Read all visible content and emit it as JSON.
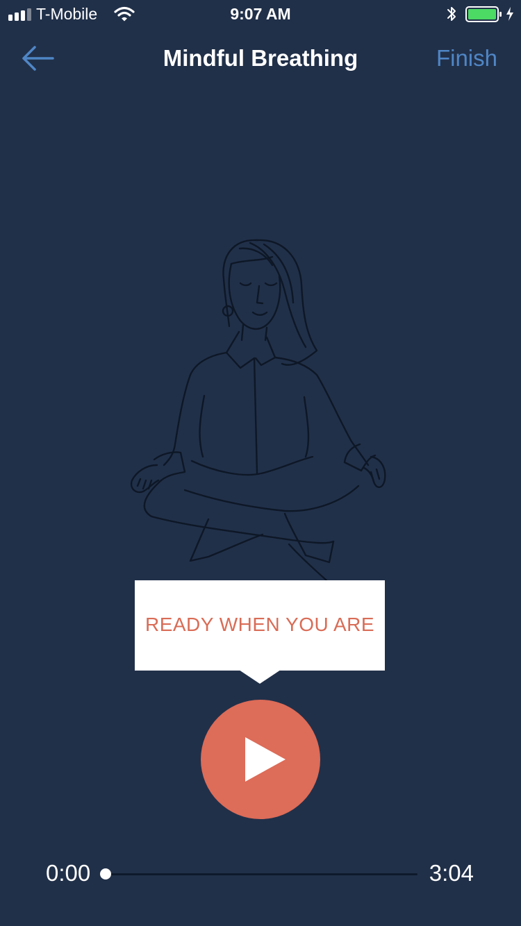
{
  "status_bar": {
    "carrier": "T-Mobile",
    "time": "9:07 AM",
    "icons": [
      "signal-icon",
      "wifi-icon",
      "bluetooth-icon",
      "battery-icon",
      "charging-icon"
    ]
  },
  "nav": {
    "back_icon": "arrow-left-icon",
    "title": "Mindful Breathing",
    "finish_label": "Finish"
  },
  "illustration": {
    "subject": "meditating-woman-icon"
  },
  "tooltip": {
    "text": "READY WHEN YOU ARE"
  },
  "player": {
    "play_icon": "play-icon",
    "elapsed": "0:00",
    "total": "3:04",
    "progress": 0
  },
  "colors": {
    "background": "#213049",
    "accent": "#dd6c58",
    "link": "#4f86c6",
    "tooltip_text": "#d96c56",
    "battery": "#4cd964"
  }
}
